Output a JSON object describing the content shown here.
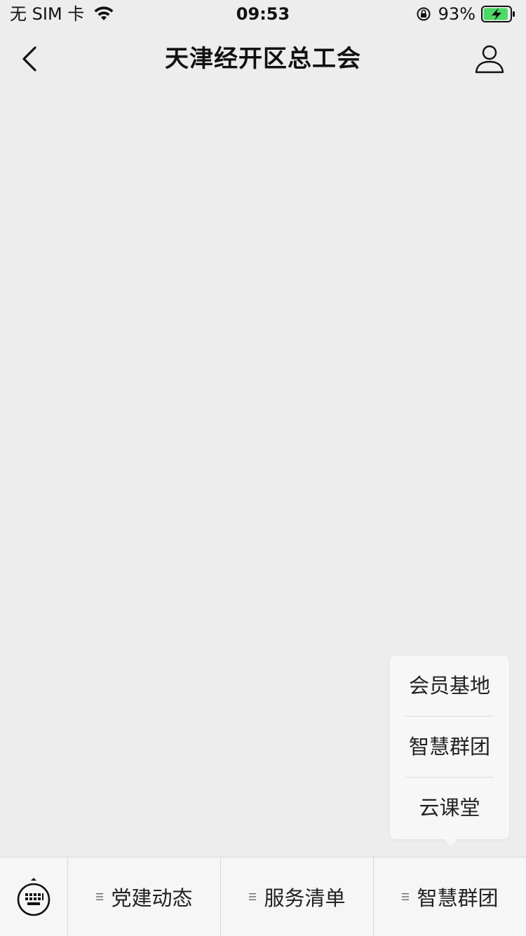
{
  "status_bar": {
    "carrier": "无 SIM 卡",
    "time": "09:53",
    "battery_percent": "93%",
    "battery_level": 0.93,
    "battery_color": "#4cd964"
  },
  "header": {
    "title": "天津经开区总工会"
  },
  "popup_menu": {
    "items": [
      "会员基地",
      "智慧群团",
      "云课堂"
    ]
  },
  "bottom_menu": {
    "items": [
      {
        "label": "党建动态"
      },
      {
        "label": "服务清单"
      },
      {
        "label": "智慧群团"
      }
    ]
  },
  "icons": {
    "back": "chevron-left-icon",
    "profile": "person-icon",
    "keyboard": "keyboard-icon",
    "menu": "lines-icon",
    "wifi": "wifi-icon",
    "lock": "rotation-lock-icon",
    "battery": "battery-charging-icon"
  }
}
